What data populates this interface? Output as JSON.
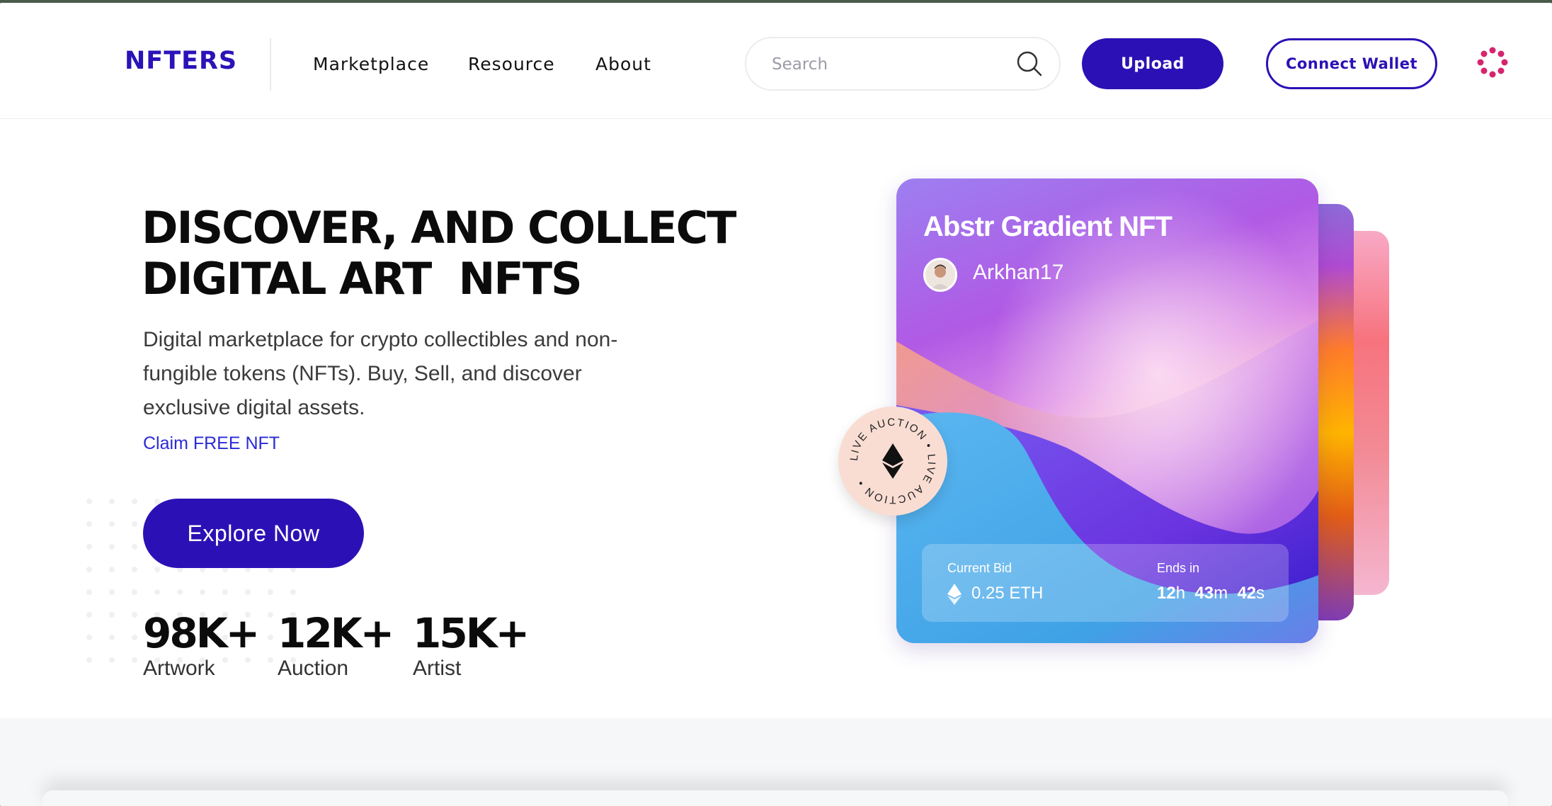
{
  "header": {
    "logo": "NFTERS",
    "nav": [
      "Marketplace",
      "Resource",
      "About"
    ],
    "search_placeholder": "Search",
    "upload_label": "Upload",
    "connect_wallet_label": "Connect Wallet"
  },
  "hero": {
    "title_line1": "DISCOVER, AND COLLECT",
    "title_line2": "DIGITAL ART  NFTS",
    "description": "Digital marketplace for crypto collectibles and non-fungible tokens (NFTs). Buy, Sell, and discover exclusive digital assets.",
    "claim_link": "Claim FREE NFT",
    "explore_label": "Explore Now",
    "stats": [
      {
        "value": "98K+",
        "label": "Artwork"
      },
      {
        "value": "12K+",
        "label": "Auction"
      },
      {
        "value": "15K+",
        "label": "Artist"
      }
    ]
  },
  "nft_card": {
    "title": "Abstr Gradient NFT",
    "creator": "Arkhan17",
    "current_bid_label": "Current Bid",
    "current_bid_value": "0.25 ETH",
    "ends_in_label": "Ends in",
    "ends_hours": "12",
    "ends_minutes": "43",
    "ends_seconds": "42",
    "badge_text": "LIVE  AUCTION  •  LIVE  AUCTION  •"
  },
  "colors": {
    "brand": "#2b11b5",
    "link": "#2a2ad6",
    "menu_icon": "#d6246e"
  }
}
